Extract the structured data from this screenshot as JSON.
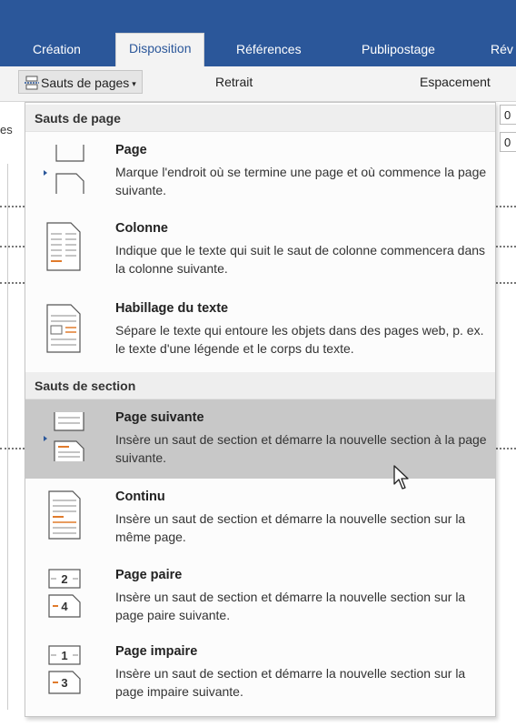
{
  "ribbon_tabs": [
    "Création",
    "Disposition",
    "Références",
    "Publipostage",
    "Rév"
  ],
  "toolbar": {
    "breaks_button": "Sauts de pages",
    "indent_label": "Retrait",
    "spacing_label": "Espacement"
  },
  "side_values": [
    "0",
    "0"
  ],
  "left_fragment": "es",
  "menu": {
    "page_breaks_header": "Sauts de page",
    "section_breaks_header": "Sauts de section",
    "items": [
      {
        "title": "Page",
        "desc": "Marque l'endroit où se termine une page et où commence la page suivante."
      },
      {
        "title": "Colonne",
        "desc": "Indique que le texte qui suit le saut de colonne commencera dans la colonne suivante."
      },
      {
        "title": "Habillage du texte",
        "desc": "Sépare le texte qui entoure les objets dans des pages web, p. ex. le texte d'une légende et le corps du texte."
      },
      {
        "title": "Page suivante",
        "desc": "Insère un saut de section et démarre la nouvelle section à la page suivante."
      },
      {
        "title": "Continu",
        "desc": "Insère un saut de section et démarre la nouvelle section sur la même page."
      },
      {
        "title": "Page paire",
        "desc": "Insère un saut de section et démarre la nouvelle section sur la page paire suivante."
      },
      {
        "title": "Page impaire",
        "desc": "Insère un saut de section et démarre la nouvelle section sur la page impaire suivante."
      }
    ],
    "even_icon_numbers": [
      "2",
      "4"
    ],
    "odd_icon_numbers": [
      "1",
      "3"
    ]
  },
  "colors": {
    "ribbon_blue": "#2b579a",
    "accent_orange": "#e07b2c",
    "highlight": "#c8c8c8"
  }
}
